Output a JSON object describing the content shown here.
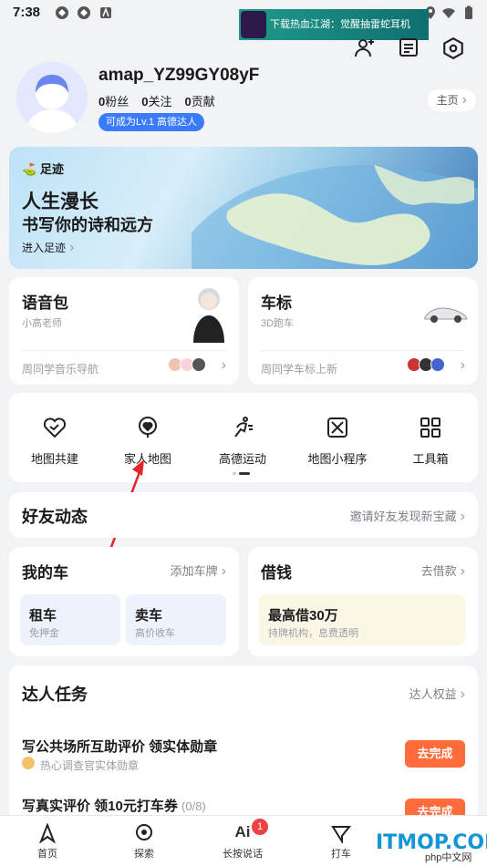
{
  "status_bar": {
    "time": "7:38"
  },
  "ad": {
    "text": "下载热血江湖：觉醒抽雷蛇耳机"
  },
  "profile": {
    "username": "amap_YZ99GY08yF",
    "fans_count": "0",
    "fans_label": "粉丝",
    "follow_count": "0",
    "follow_label": "关注",
    "contrib_count": "0",
    "contrib_label": "贡献",
    "level_badge": "可成为Lv.1 高德达人",
    "home_link": "主页"
  },
  "hero": {
    "tag": "足迹",
    "line1": "人生漫长",
    "line2": "书写你的诗和远方",
    "link": "进入足迹"
  },
  "voice_pack": {
    "title": "语音包",
    "subtitle": "小高老师",
    "footer": "周同学音乐导航"
  },
  "car_logo": {
    "title": "车标",
    "subtitle": "3D跑车",
    "footer": "周同学车标上新"
  },
  "tools": [
    {
      "label": "地图共建",
      "icon": "heart-handshake-icon"
    },
    {
      "label": "家人地图",
      "icon": "family-heart-icon"
    },
    {
      "label": "高德运动",
      "icon": "running-icon"
    },
    {
      "label": "地图小程序",
      "icon": "mini-program-icon"
    },
    {
      "label": "工具箱",
      "icon": "grid-icon"
    }
  ],
  "friends": {
    "title": "好友动态",
    "link": "邀请好友发现新宝藏"
  },
  "my_car": {
    "title": "我的车",
    "link": "添加车牌",
    "rent_title": "租车",
    "rent_sub": "免押金",
    "sell_title": "卖车",
    "sell_sub": "高价收车"
  },
  "loan": {
    "title": "借钱",
    "link": "去借款",
    "box_title": "最高借30万",
    "box_sub": "持牌机构，息费透明"
  },
  "tasks": {
    "title": "达人任务",
    "link": "达人权益",
    "items": [
      {
        "title": "写公共场所互助评价 领实体勋章",
        "sub": "热心调查官实体勋章",
        "button": "去完成"
      },
      {
        "title": "写真实评价 领10元打车券",
        "progress": "(0/8)",
        "button": "去完成"
      }
    ]
  },
  "bottom_nav": {
    "home": "首页",
    "search": "探索",
    "ai": "长按说话",
    "ai_badge": "1",
    "taxi": "打车"
  },
  "watermark": {
    "main": "ITMOP.COM",
    "sub": "php中文网"
  },
  "colors": {
    "accent": "#3a7bfd",
    "orange": "#ff6b3a",
    "badge": "#f04142"
  }
}
